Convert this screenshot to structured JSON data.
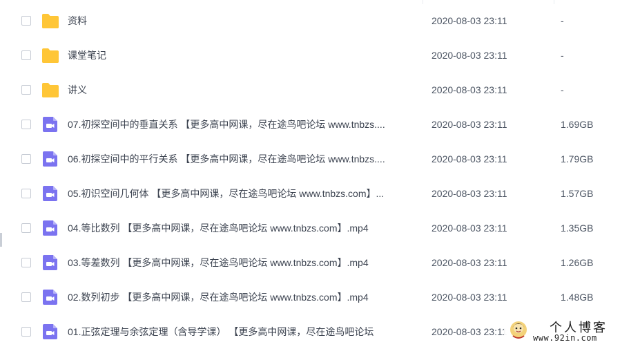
{
  "colors": {
    "folder": "#ffc637",
    "video": "#7b73f0",
    "text": "#3c4350",
    "divider": "#e9ecf0"
  },
  "files": [
    {
      "type": "folder",
      "icon": "folder-icon",
      "name": "资料",
      "date": "2020-08-03 23:11",
      "size": "-"
    },
    {
      "type": "folder",
      "icon": "folder-icon",
      "name": "课堂笔记",
      "date": "2020-08-03 23:11",
      "size": "-"
    },
    {
      "type": "folder",
      "icon": "folder-icon",
      "name": "讲义",
      "date": "2020-08-03 23:11",
      "size": "-"
    },
    {
      "type": "video",
      "icon": "video-file-icon",
      "name": "07.初探空间中的垂直关系 【更多高中网课，尽在途鸟吧论坛 www.tnbzs....",
      "date": "2020-08-03 23:11",
      "size": "1.69GB"
    },
    {
      "type": "video",
      "icon": "video-file-icon",
      "name": "06.初探空间中的平行关系 【更多高中网课，尽在途鸟吧论坛 www.tnbzs....",
      "date": "2020-08-03 23:11",
      "size": "1.79GB"
    },
    {
      "type": "video",
      "icon": "video-file-icon",
      "name": "05.初识空间几何体 【更多高中网课，尽在途鸟吧论坛 www.tnbzs.com】...",
      "date": "2020-08-03 23:11",
      "size": "1.57GB"
    },
    {
      "type": "video",
      "icon": "video-file-icon",
      "name": "04.等比数列 【更多高中网课，尽在途鸟吧论坛 www.tnbzs.com】.mp4",
      "date": "2020-08-03 23:11",
      "size": "1.35GB"
    },
    {
      "type": "video",
      "icon": "video-file-icon",
      "name": "03.等差数列 【更多高中网课，尽在途鸟吧论坛 www.tnbzs.com】.mp4",
      "date": "2020-08-03 23:11",
      "size": "1.26GB"
    },
    {
      "type": "video",
      "icon": "video-file-icon",
      "name": "02.数列初步 【更多高中网课，尽在途鸟吧论坛 www.tnbzs.com】.mp4",
      "date": "2020-08-03 23:11",
      "size": "1.48GB"
    },
    {
      "type": "video",
      "icon": "video-file-icon",
      "name": "01.正弦定理与余弦定理（含导学课） 【更多高中网课，尽在途鸟吧论坛",
      "date": "2020-08-03 23:11",
      "size": ""
    }
  ],
  "watermark": {
    "title": "个人博客",
    "url": "www.92in.com"
  }
}
